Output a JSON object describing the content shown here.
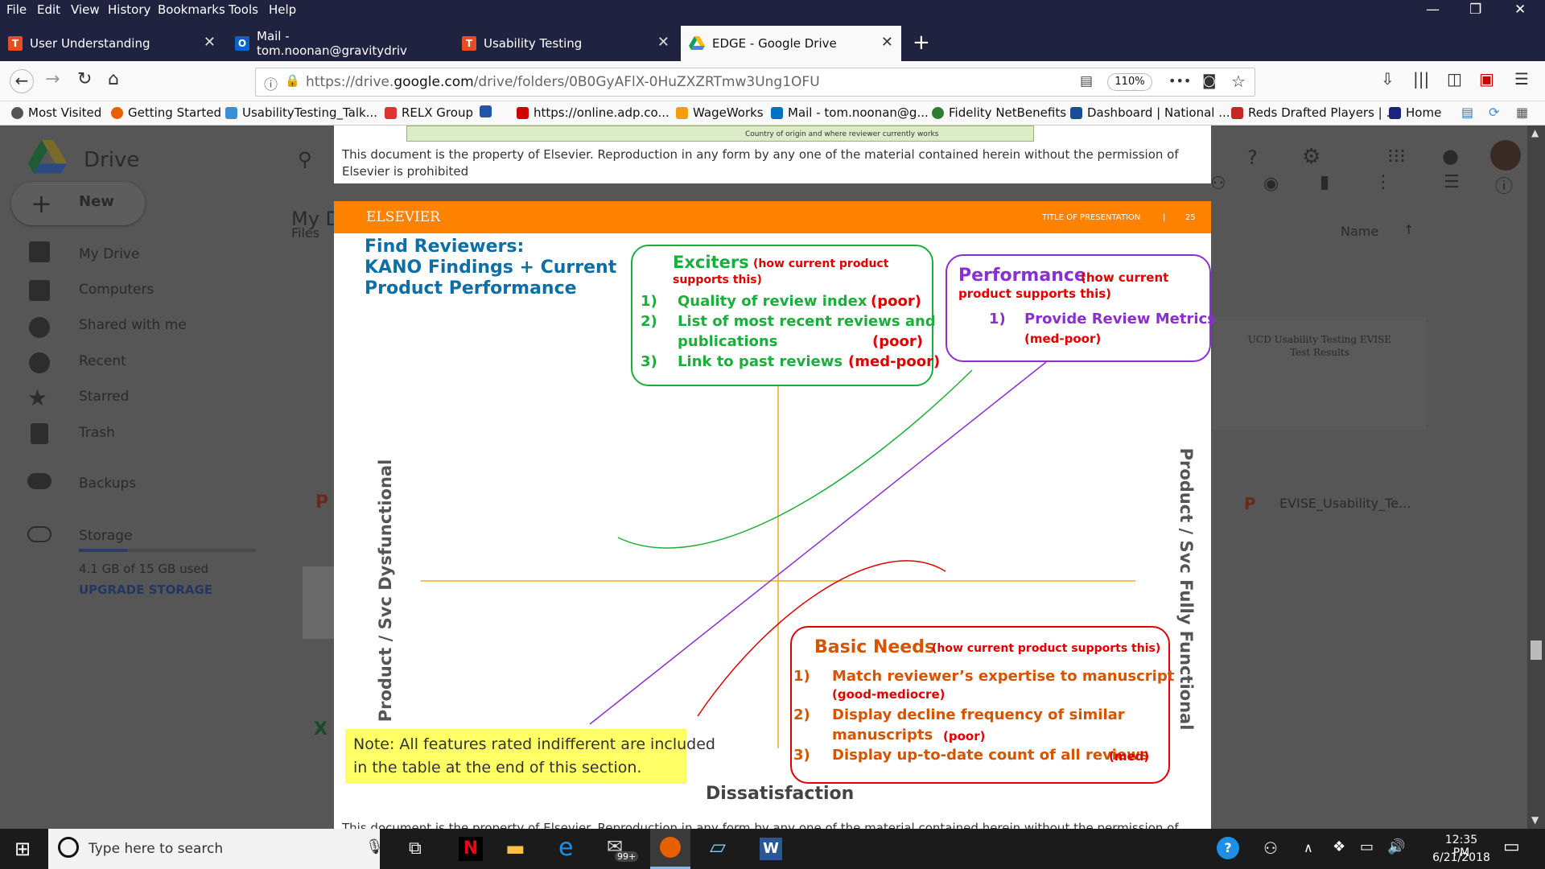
{
  "menu": {
    "items": [
      "File",
      "Edit",
      "View",
      "History",
      "Bookmarks",
      "Tools",
      "Help"
    ]
  },
  "tabs": [
    {
      "label": "User Understanding",
      "icon": "T"
    },
    {
      "label": "Mail - tom.noonan@gravitydriv",
      "icon": "O"
    },
    {
      "label": "Usability Testing",
      "icon": "T"
    },
    {
      "label": "EDGE - Google Drive",
      "icon": "drive"
    }
  ],
  "nav": {
    "url_prefix": "https://drive.",
    "url_domain": "google.com",
    "url_rest": "/drive/folders/0B0GyAFlX-0HuZXZRTmw3Ung1OFU",
    "zoom": "110%",
    "more": "•••"
  },
  "bookmarks": [
    {
      "label": "Most Visited",
      "color": "#555"
    },
    {
      "label": "Getting Started",
      "color": "#e66000"
    },
    {
      "label": "UsabilityTesting_Talk...",
      "color": "#3b8fd8"
    },
    {
      "label": "RELX Group",
      "color": "#d33"
    },
    {
      "label": "",
      "color": "#2255aa"
    },
    {
      "label": "https://online.adp.co...",
      "color": "#d10000"
    },
    {
      "label": "WageWorks",
      "color": "#f39c12"
    },
    {
      "label": "Mail - tom.noonan@g...",
      "color": "#0072c6"
    },
    {
      "label": "Fidelity NetBenefits",
      "color": "#2e7d32"
    },
    {
      "label": "Dashboard | National ...",
      "color": "#1a4d99"
    },
    {
      "label": "Reds Drafted Players | ...",
      "color": "#c62828"
    },
    {
      "label": "Home",
      "color": "#1a237e"
    }
  ],
  "drive": {
    "logo": "Drive",
    "new": "New",
    "header_partial": "My D",
    "files_label": "Files",
    "name_col": "Name",
    "sidebar": [
      "My Drive",
      "Computers",
      "Shared with me",
      "Recent",
      "Starred",
      "Trash",
      "Backups",
      "Storage"
    ],
    "storage_used": "4.1 GB of 15 GB used",
    "upgrade": "UPGRADE STORAGE",
    "file_thumb_title": "UCD Usability Testing EVISE Test Results",
    "file_name": "EVISE_Usability_Te..."
  },
  "top_panel": {
    "caption": "Country of origin and where reviewer currently works",
    "footer": "This document is the property of Elsevier. Reproduction in any form by any one of the material contained herein without the permission of Elsevier is prohibited"
  },
  "slide": {
    "brand": "ELSEVIER",
    "hdr_right": "TITLE OF PRESENTATION",
    "hdr_sep": "|",
    "page": "25",
    "title_lines": [
      "Find Reviewers:",
      "KANO Findings + Current",
      "Product Performance"
    ],
    "exciters": {
      "title": "Exciters",
      "sub1": "(how current product",
      "sub2": "supports this)",
      "items": [
        {
          "num": "1)",
          "text": "Quality of review index",
          "rating": "(poor)"
        },
        {
          "num": "2)",
          "text": "List of most recent reviews and",
          "text2": "publications",
          "rating": "(poor)"
        },
        {
          "num": "3)",
          "text": "Link to past reviews",
          "rating": "(med-poor)"
        }
      ]
    },
    "performance": {
      "title": "Performance",
      "sub1": "(how current",
      "sub2": "product supports this)",
      "items": [
        {
          "num": "1)",
          "text": "Provide Review Metrics",
          "rating": "(med-poor)"
        }
      ]
    },
    "basic": {
      "title": "Basic Needs",
      "sub": "(how current product supports this)",
      "items": [
        {
          "num": "1)",
          "text": "Match reviewer’s expertise to manuscript",
          "rating": "(good-mediocre)"
        },
        {
          "num": "2)",
          "text": "Display decline frequency of similar",
          "text2": "manuscripts",
          "rating": "(poor)"
        },
        {
          "num": "3)",
          "text": "Display up-to-date count of all reviews",
          "rating": "(med)"
        }
      ]
    },
    "y_left": "Product / Svc Dysfunctional",
    "y_right": "Product / Svc Fully Functional",
    "x_bottom": "Dissatisfaction",
    "note": [
      "Note: All features rated indifferent are included",
      "in the table at the end of this section."
    ],
    "footer_cut": "This document is the property of Elsevier. Reproduction in any form by any one of the material contained herein without the permission of"
  },
  "taskbar": {
    "search": "Type here to search",
    "badge": "99+",
    "time": "12:35 PM",
    "date": "6/21/2018"
  },
  "colors": {
    "chrome": "#202340",
    "orange": "#ff8200",
    "teal_title": "#0d6fa6",
    "green": "#1bae3b",
    "purple": "#8a2fd1",
    "red": "#e00000",
    "basic_title": "#d45500"
  }
}
